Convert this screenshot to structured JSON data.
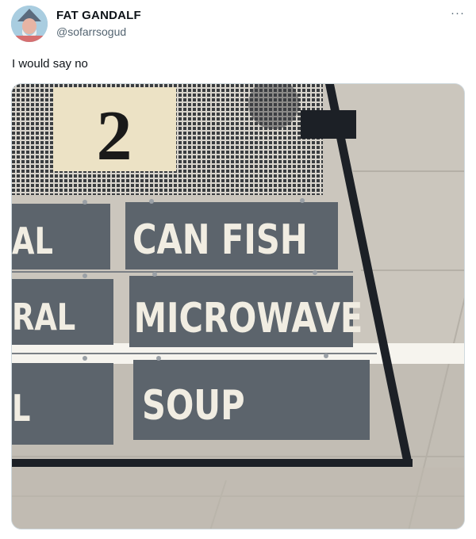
{
  "author": {
    "display_name": "FAT GANDALF",
    "handle": "@sofarrsogud",
    "avatar_icon": "wizard-avatar-icon"
  },
  "more_label": "···",
  "tweet_text": "I would say no",
  "photo": {
    "number_card": "2",
    "signs": [
      {
        "left": "AL",
        "right": "CAN FISH"
      },
      {
        "left": "RAL",
        "right": "MICROWAVE"
      },
      {
        "left": "L",
        "right": "SOUP"
      }
    ]
  },
  "colors": {
    "sign_bg": "#5c646c",
    "sign_text": "#f1ede2",
    "ceiling": "#cbc6bd",
    "frame": "#1c2026"
  }
}
